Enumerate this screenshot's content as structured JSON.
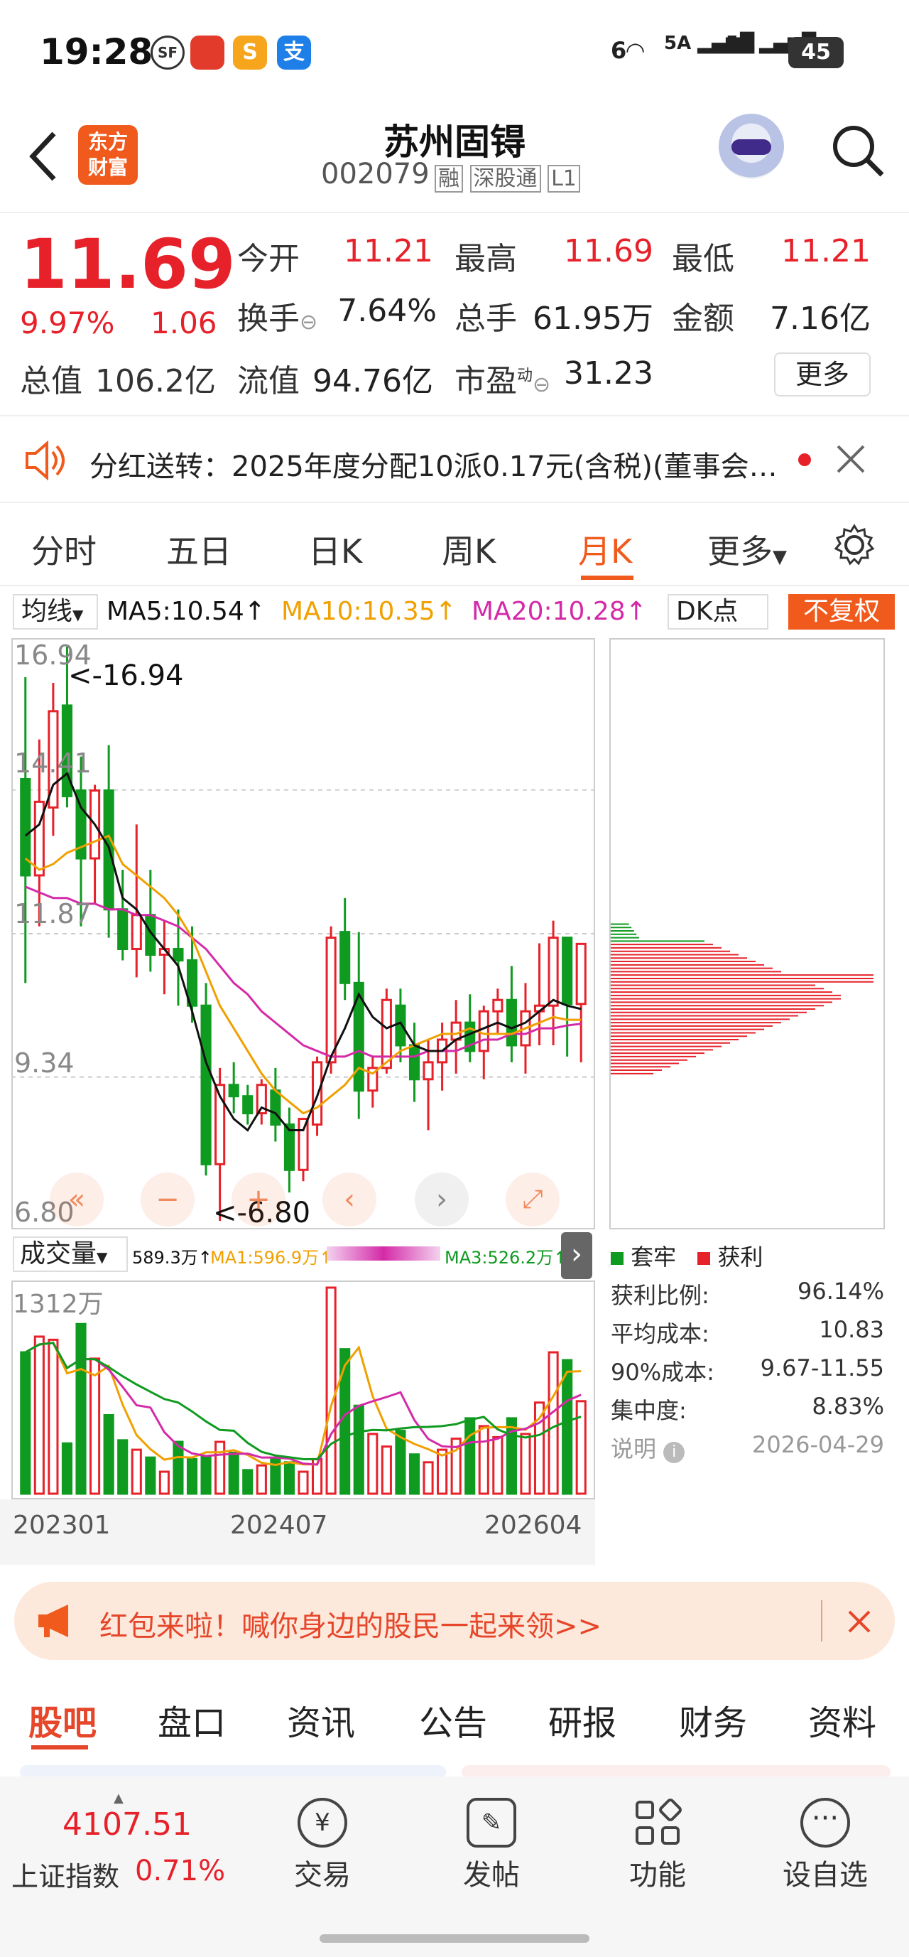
{
  "status_bar": {
    "time": "19:28",
    "app_icons": [
      "sf-express-icon",
      "app-red-icon",
      "app-yellow-icon",
      "alipay-icon"
    ],
    "app_icon_chars": [
      "SF",
      "",
      "S",
      "支"
    ],
    "network_left": "6",
    "signal1": "5A",
    "signal2": "5A",
    "battery": "45"
  },
  "header": {
    "back_icon": "back-arrow-icon",
    "logo_line1": "东方",
    "logo_line2": "财富",
    "stock_name": "苏州固锝",
    "stock_code": "002079",
    "tags": [
      "融",
      "深股通",
      "L1"
    ],
    "search_icon": "search-icon"
  },
  "quote": {
    "price": "11.69",
    "change_pct": "9.97%",
    "change_abs": "1.06",
    "market_value_label": "总值",
    "market_value": "106.2亿",
    "fields": [
      {
        "label": "今开",
        "value": "11.21"
      },
      {
        "label": "最高",
        "value": "11.69"
      },
      {
        "label": "最低",
        "value": "11.21"
      },
      {
        "label": "换手",
        "value": "7.64%"
      },
      {
        "label": "总手",
        "value": "61.95万"
      },
      {
        "label": "金额",
        "value": "7.16亿"
      },
      {
        "label": "流值",
        "value": "94.76亿"
      },
      {
        "label": "市盈",
        "value": "31.23"
      }
    ],
    "pe_superscript": "动",
    "more_button": "更多"
  },
  "notice": {
    "text": "分红送转：2025年度分配10派0.17元(含税)(董事会…"
  },
  "tabs": {
    "items": [
      "分时",
      "五日",
      "日K",
      "周K",
      "月K",
      "更多"
    ],
    "active": "月K"
  },
  "ma_bar": {
    "selector": "均线",
    "ma5": "MA5:10.54",
    "ma10": "MA10:10.35",
    "ma20": "MA20:10.28",
    "dk": "DK点",
    "fuquan": "不复权"
  },
  "kline": {
    "y_labels": [
      "16.94",
      "14.41",
      "11.87",
      "9.34",
      "6.80"
    ],
    "max_annotation": "<-16.94",
    "min_annotation": "<-6.80",
    "ohlc": [
      [
        14.6,
        16.4,
        11.0,
        12.9
      ],
      [
        12.9,
        15.3,
        12.0,
        14.2
      ],
      [
        14.1,
        16.3,
        13.6,
        15.8
      ],
      [
        15.9,
        16.94,
        14.1,
        14.3
      ],
      [
        14.4,
        15.0,
        12.0,
        13.2
      ],
      [
        13.2,
        14.5,
        12.4,
        14.4
      ],
      [
        14.4,
        15.2,
        11.8,
        12.3
      ],
      [
        12.3,
        13.0,
        11.4,
        11.6
      ],
      [
        11.6,
        13.8,
        11.1,
        12.2
      ],
      [
        12.2,
        13.0,
        11.2,
        11.5
      ],
      [
        11.5,
        12.1,
        10.8,
        11.6
      ],
      [
        11.6,
        12.3,
        10.6,
        11.4
      ],
      [
        11.4,
        12.0,
        10.3,
        10.6
      ],
      [
        10.6,
        11.0,
        7.6,
        7.8
      ],
      [
        7.8,
        9.5,
        6.8,
        9.2
      ],
      [
        9.2,
        9.6,
        8.7,
        9.0
      ],
      [
        9.0,
        9.2,
        8.5,
        8.7
      ],
      [
        8.7,
        9.3,
        8.5,
        9.2
      ],
      [
        9.1,
        9.5,
        8.2,
        8.5
      ],
      [
        8.5,
        8.8,
        7.3,
        7.7
      ],
      [
        7.7,
        8.6,
        7.5,
        8.6
      ],
      [
        8.5,
        9.7,
        8.3,
        9.6
      ],
      [
        9.6,
        12.0,
        9.4,
        11.8
      ],
      [
        11.9,
        12.5,
        10.7,
        11.0
      ],
      [
        11.0,
        11.9,
        8.6,
        9.1
      ],
      [
        9.1,
        9.7,
        8.8,
        9.5
      ],
      [
        9.5,
        10.9,
        9.4,
        10.7
      ],
      [
        10.6,
        10.9,
        9.6,
        9.9
      ],
      [
        9.9,
        10.3,
        8.9,
        9.3
      ],
      [
        9.3,
        10.0,
        8.4,
        9.6
      ],
      [
        9.6,
        10.3,
        9.1,
        10.0
      ],
      [
        10.0,
        10.7,
        9.4,
        10.3
      ],
      [
        10.3,
        10.8,
        9.6,
        9.8
      ],
      [
        9.8,
        10.6,
        9.3,
        10.5
      ],
      [
        10.5,
        10.9,
        10.1,
        10.7
      ],
      [
        10.7,
        11.3,
        9.6,
        9.9
      ],
      [
        9.9,
        11.0,
        9.4,
        10.5
      ],
      [
        10.5,
        11.7,
        9.9,
        10.6
      ],
      [
        10.6,
        12.1,
        9.9,
        11.8
      ],
      [
        11.8,
        11.0,
        9.7,
        10.63
      ],
      [
        10.63,
        11.69,
        9.6,
        11.69
      ]
    ],
    "ma5": [
      13.6,
      13.8,
      14.5,
      14.7,
      14.1,
      13.8,
      13.4,
      12.5,
      12.3,
      11.9,
      11.6,
      11.3,
      10.5,
      9.6,
      9.0,
      8.6,
      8.4,
      8.8,
      8.7,
      8.4,
      8.4,
      9.0,
      9.7,
      10.2,
      10.8,
      10.4,
      10.2,
      10.3,
      9.9,
      9.8,
      9.8,
      10.0,
      10.1,
      10.2,
      10.3,
      10.2,
      10.3,
      10.5,
      10.7,
      10.6,
      10.54
    ],
    "ma10": [
      13.2,
      13.0,
      13.1,
      13.3,
      13.4,
      13.5,
      13.6,
      13.1,
      12.9,
      12.7,
      12.5,
      12.2,
      11.8,
      11.2,
      10.6,
      10.2,
      9.8,
      9.4,
      9.1,
      8.9,
      8.7,
      8.8,
      9.0,
      9.2,
      9.5,
      9.4,
      9.6,
      9.8,
      9.9,
      10.0,
      10.1,
      10.1,
      10.2,
      10.1,
      10.1,
      10.1,
      10.2,
      10.3,
      10.4,
      10.35,
      10.35
    ],
    "ma20": [
      12.7,
      12.6,
      12.5,
      12.5,
      12.4,
      12.4,
      12.3,
      12.3,
      12.2,
      12.2,
      12.1,
      12.0,
      11.8,
      11.6,
      11.3,
      11.0,
      10.8,
      10.5,
      10.3,
      10.1,
      9.9,
      9.8,
      9.7,
      9.7,
      9.8,
      9.7,
      9.7,
      9.7,
      9.7,
      9.8,
      9.8,
      9.8,
      9.9,
      10.0,
      10.0,
      10.1,
      10.1,
      10.2,
      10.2,
      10.25,
      10.28
    ]
  },
  "volume": {
    "selector": "成交量",
    "vol_label": "589.3万",
    "ma1": "MA1:596.9万",
    "ma3": "MA3:526.2万",
    "y_label": "1312万",
    "x_labels": [
      "202301",
      "202407",
      "202604"
    ],
    "values": [
      900,
      1000,
      980,
      320,
      1080,
      860,
      500,
      340,
      280,
      230,
      140,
      330,
      220,
      240,
      330,
      260,
      150,
      180,
      220,
      200,
      140,
      220,
      1312,
      920,
      560,
      380,
      300,
      400,
      250,
      200,
      280,
      350,
      480,
      430,
      360,
      480,
      380,
      580,
      900,
      850,
      589
    ]
  },
  "chips": {
    "legend_loss": "套牢",
    "legend_profit": "获利",
    "stats": [
      {
        "label": "获利比例:",
        "value": "96.14%"
      },
      {
        "label": "平均成本:",
        "value": "10.83"
      },
      {
        "label": "90%成本:",
        "value": "9.67-11.55"
      },
      {
        "label": "集中度:",
        "value": "8.83%"
      },
      {
        "label": "说明",
        "value": "2026-04-29"
      }
    ]
  },
  "promo": {
    "text": "红包来啦！喊你身边的股民一起来领>>"
  },
  "bottom_tabs": [
    "股吧",
    "盘口",
    "资讯",
    "公告",
    "研报",
    "财务",
    "资料"
  ],
  "bottom_nav": {
    "index_value": "4107.51",
    "index_name": "上证指数",
    "index_change": "0.71%",
    "items": [
      "交易",
      "发帖",
      "功能",
      "设自选"
    ]
  },
  "colors": {
    "up": "#e6212a",
    "down": "#0f9a20",
    "ma5": "#111111",
    "ma10": "#f0a000",
    "ma20": "#d42aa8",
    "accent": "#f05a1c"
  }
}
